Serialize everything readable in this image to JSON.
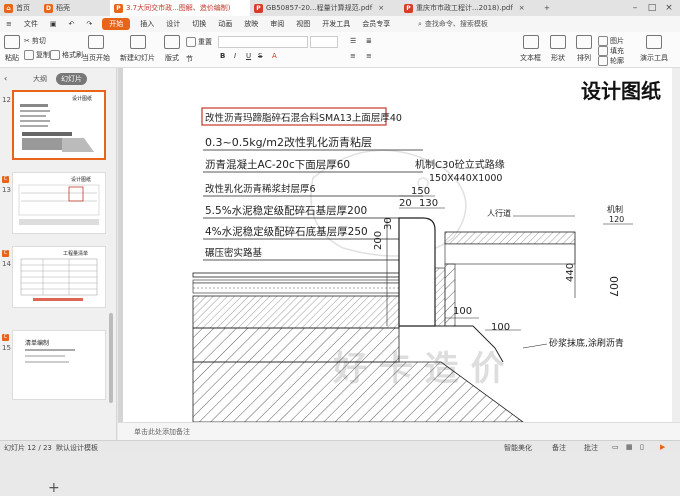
{
  "window_tabs": [
    {
      "label": "首页",
      "icon": "home-icon",
      "color": "#e8641b"
    },
    {
      "label": "稻壳",
      "icon": "docer-icon",
      "color": "#e8641b"
    },
    {
      "label": "3.7大同交市政...图解、造价编制)",
      "icon": "ppt-icon",
      "color": "#e8641b"
    },
    {
      "label": "GB50857-20...程量计算规范.pdf",
      "icon": "pdf-icon",
      "color": "#d93b2b"
    },
    {
      "label": "重庆市市政工程计...2018).pdf",
      "icon": "pdf-icon",
      "color": "#d93b2b"
    }
  ],
  "menu": {
    "file": "文件",
    "items": [
      "开始",
      "插入",
      "设计",
      "切换",
      "动画",
      "放映",
      "审阅",
      "视图",
      "开发工具",
      "会员专享"
    ],
    "active": "开始",
    "search_placeholder": "查找命令、搜索模板"
  },
  "ribbon": {
    "paste": "粘贴",
    "cut": "剪切",
    "copy": "复制",
    "format_painter": "格式刷",
    "from_current": "当页开始",
    "new_slide": "新建幻灯片",
    "layout": "版式",
    "section": "节",
    "reset": "重置",
    "textbox": "文本框",
    "shape": "形状",
    "arrange": "排列",
    "picture": "图片",
    "fill": "填充",
    "outline": "轮廓",
    "presenter_tools": "演示工具"
  },
  "panel": {
    "tabs": [
      "大纲",
      "幻灯片"
    ],
    "active_tab": "幻灯片",
    "slides": [
      {
        "number": "12",
        "title": "设计图纸",
        "selected": true
      },
      {
        "number": "13",
        "title": "设计图纸",
        "selected": false
      },
      {
        "number": "14",
        "title": "工程量清单",
        "selected": false
      },
      {
        "number": "15",
        "title": "清单编制",
        "selected": false
      }
    ],
    "add_label": "+"
  },
  "slide": {
    "title": "设计图纸",
    "layers": [
      "改性沥青玛蹄脂碎石混合料SMA13上面层厚40",
      "0.3~0.5kg/m2改性乳化沥青粘层",
      "沥青混凝土AC-20c下面层厚60",
      "改性乳化沥青稀浆封层厚6",
      "5.5%水泥稳定级配碎石基层厚200",
      "4%水泥稳定级配碎石底基层厚250",
      "碾压密实路基"
    ],
    "curb_label": "机制C30砼立式路缘",
    "curb_size": "150X440X1000",
    "dim_150": "150",
    "dim_20": "20",
    "dim_130": "130",
    "dim_200": "200",
    "dim_30": "30",
    "dim_440": "440",
    "dim_100a": "100",
    "dim_100b": "100",
    "sidewalk": "人行道",
    "right_label1": "机制",
    "right_label2": "120",
    "right_label3": "007",
    "mortar": "砂浆抹底,涂刷沥青",
    "watermark": "好 卡 造 价"
  },
  "notes_placeholder": "单击此处添加备注",
  "status": {
    "slide_count": "幻灯片 12 / 23",
    "template": "默认设计模板",
    "beautify": "智能美化",
    "notes": "备注",
    "comment": "批注"
  }
}
